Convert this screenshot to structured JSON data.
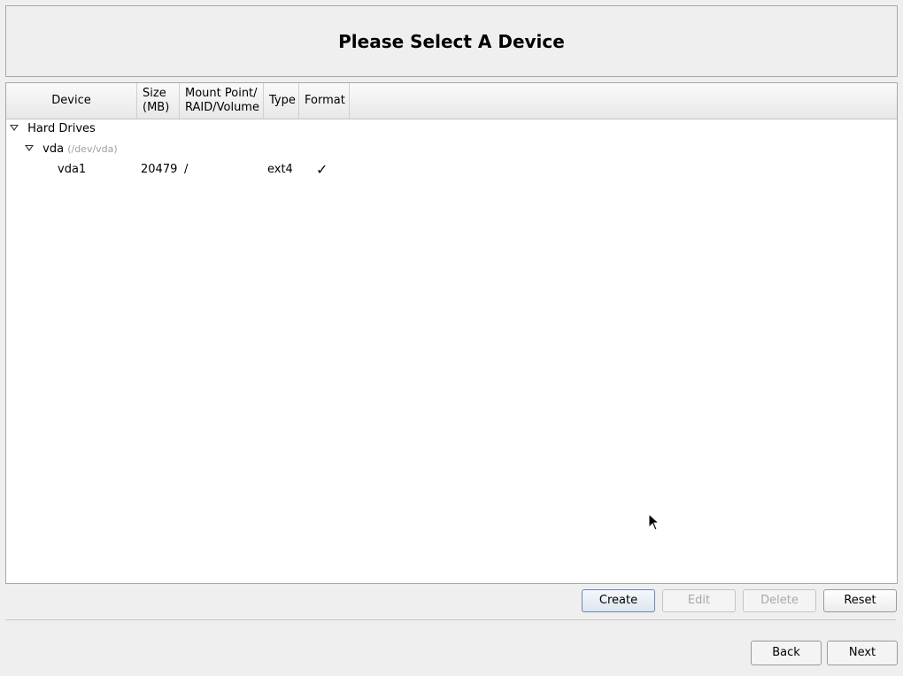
{
  "header": {
    "title": "Please Select A Device"
  },
  "table": {
    "columns": [
      {
        "label_line1": "Device",
        "label_line2": ""
      },
      {
        "label_line1": "Size",
        "label_line2": "(MB)"
      },
      {
        "label_line1": "Mount Point/",
        "label_line2": "RAID/Volume"
      },
      {
        "label_line1": "Type",
        "label_line2": ""
      },
      {
        "label_line1": "Format",
        "label_line2": ""
      }
    ],
    "groups": {
      "hard_drives": "Hard Drives",
      "disk_name": "vda",
      "disk_path": "(/dev/vda)"
    },
    "rows": [
      {
        "device": "vda1",
        "size": "20479",
        "mount": "/",
        "type": "ext4",
        "format": "✓"
      }
    ]
  },
  "buttons": {
    "create": "Create",
    "edit": "Edit",
    "delete": "Delete",
    "reset": "Reset",
    "back": "Back",
    "next": "Next"
  }
}
